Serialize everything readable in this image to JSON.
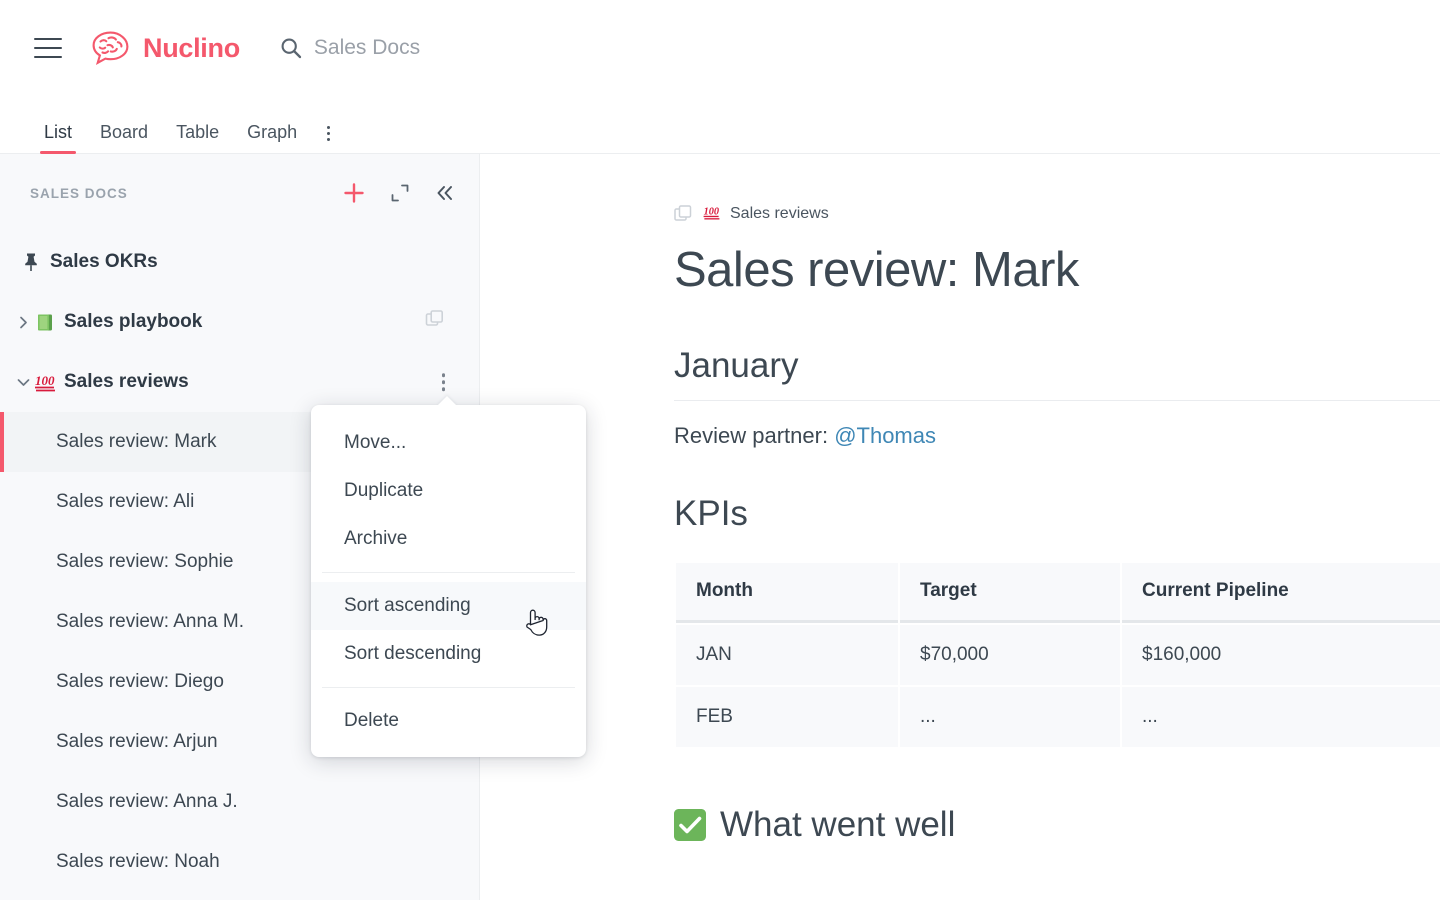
{
  "app": {
    "brand_name": "Nuclino",
    "logo_icon": "brain-speech-bubble-icon",
    "menu_icon": "hamburger-menu-icon",
    "accent_color": "#f4586c"
  },
  "search": {
    "icon": "search-icon",
    "value": "Sales Docs"
  },
  "tabs": [
    {
      "label": "List",
      "active": true
    },
    {
      "label": "Board",
      "active": false
    },
    {
      "label": "Table",
      "active": false
    },
    {
      "label": "Graph",
      "active": false
    }
  ],
  "tabs_more_icon": "more-vertical-icon",
  "sidebar": {
    "title": "SALES DOCS",
    "actions": [
      {
        "name": "add-item-button",
        "icon": "plus-icon"
      },
      {
        "name": "expand-button",
        "icon": "expand-icon"
      },
      {
        "name": "collapse-sidebar-button",
        "icon": "chevrons-left-icon"
      }
    ],
    "items": [
      {
        "label": "Sales OKRs",
        "icon": "pin-icon",
        "type": "pinned"
      },
      {
        "label": "Sales playbook",
        "emoji": "green-book-emoji",
        "caret": "›",
        "trailing_icon": "duplicate-icon",
        "type": "cluster"
      },
      {
        "label": "Sales reviews",
        "emoji": "hundred-points-emoji",
        "caret": "⌄",
        "trailing_icon": "more-vertical-icon",
        "type": "cluster",
        "expanded": true
      }
    ],
    "children": [
      {
        "label": "Sales review: Mark",
        "selected": true
      },
      {
        "label": "Sales review: Ali",
        "selected": false
      },
      {
        "label": "Sales review: Sophie",
        "selected": false
      },
      {
        "label": "Sales review: Anna M.",
        "selected": false
      },
      {
        "label": "Sales review: Diego",
        "selected": false
      },
      {
        "label": "Sales review: Arjun",
        "selected": false
      },
      {
        "label": "Sales review: Anna J.",
        "selected": false
      },
      {
        "label": "Sales review: Noah",
        "selected": false
      }
    ]
  },
  "context_menu": {
    "items": [
      {
        "label": "Move...",
        "hover": false
      },
      {
        "label": "Duplicate",
        "hover": false
      },
      {
        "label": "Archive",
        "hover": false
      },
      {
        "label": "Sort ascending",
        "hover": true
      },
      {
        "label": "Sort descending",
        "hover": false
      },
      {
        "label": "Delete",
        "hover": false
      }
    ]
  },
  "cursor": {
    "icon": "pointing-hand-cursor"
  },
  "document": {
    "breadcrumb": {
      "icon": "stacked-pages-icon",
      "emoji": "hundred-points-emoji",
      "label": "Sales reviews"
    },
    "title": "Sales review: Mark",
    "heading_month": "January",
    "review_partner_label": "Review partner: ",
    "review_partner_mention": "@Thomas",
    "heading_kpis": "KPIs",
    "kpi_table": {
      "columns": [
        "Month",
        "Target",
        "Current Pipeline"
      ],
      "rows": [
        [
          "JAN",
          "$70,000",
          "$160,000"
        ],
        [
          "FEB",
          "...",
          "..."
        ]
      ]
    },
    "heading_went_well": "What went well",
    "went_well_emoji": "white-check-mark-emoji"
  }
}
